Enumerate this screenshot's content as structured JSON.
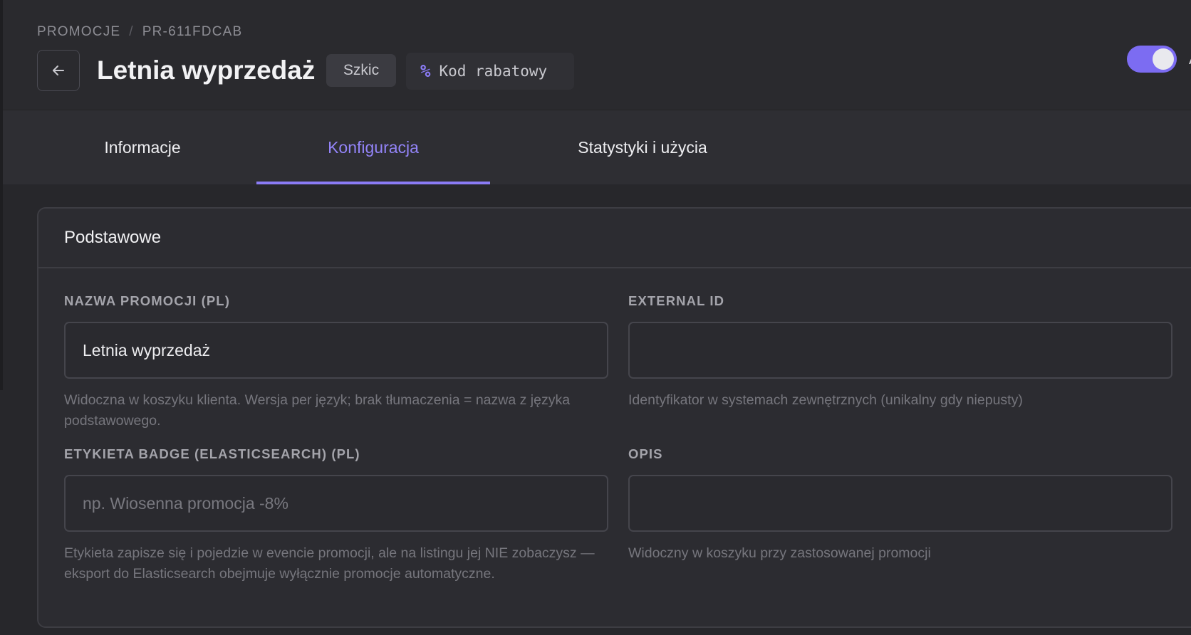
{
  "breadcrumb": {
    "section": "PROMOCJE",
    "separator": "/",
    "id": "PR-611FDCAB"
  },
  "header": {
    "title": "Letnia wyprzedaż",
    "status": "Szkic",
    "type_icon": "%",
    "type_label": "Kod rabatowy",
    "toggle_on": true,
    "toggle_label": "A"
  },
  "tabs": [
    {
      "label": "Informacje",
      "active": false
    },
    {
      "label": "Konfiguracja",
      "active": true
    },
    {
      "label": "Statystyki i użycia",
      "active": false
    }
  ],
  "section": {
    "title": "Podstawowe",
    "fields": [
      {
        "label": "NAZWA PROMOCJI (PL)",
        "value": "Letnia wyprzedaż",
        "placeholder": "",
        "help": "Widoczna w koszyku klienta. Wersja per język; brak tłumaczenia = nazwa z języka podstawowego."
      },
      {
        "label": "EXTERNAL ID",
        "value": "",
        "placeholder": "",
        "help": "Identyfikator w systemach zewnętrznych (unikalny gdy niepusty)"
      },
      {
        "label": "ETYKIETA BADGE (ELASTICSEARCH) (PL)",
        "value": "",
        "placeholder": "np. Wiosenna promocja -8%",
        "help": "Etykieta zapisze się i pojedzie w evencie promocji, ale na listingu jej NIE zobaczysz — eksport do Elasticsearch obejmuje wyłącznie promocje automatyczne."
      },
      {
        "label": "OPIS",
        "value": "",
        "placeholder": "",
        "help": "Widoczny w koszyku przy zastosowanej promocji"
      }
    ]
  },
  "colors": {
    "accent": "#8b7cf6",
    "background": "#27272b",
    "card": "#2c2c31"
  },
  "icons": {
    "back": "arrow-left-icon",
    "type": "percent-icon"
  }
}
